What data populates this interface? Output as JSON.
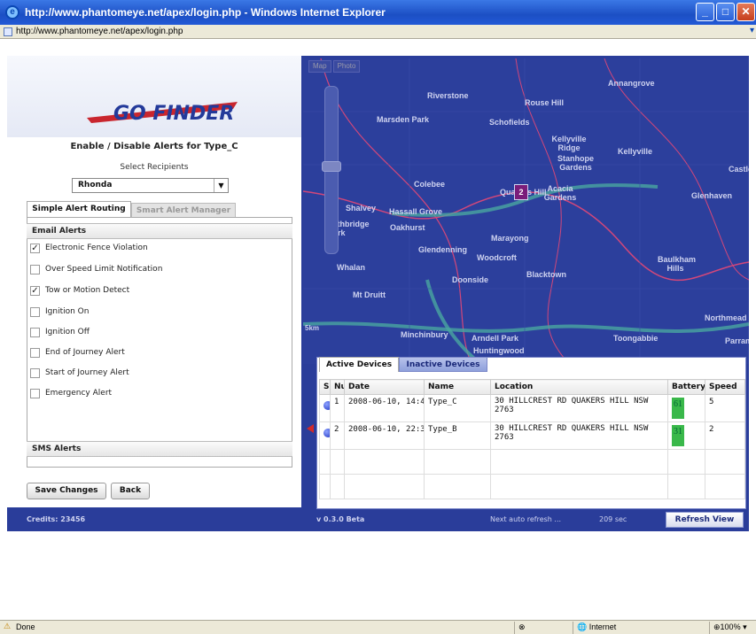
{
  "window": {
    "title": "http://www.phantomeye.net/apex/login.php - Windows Internet Explorer",
    "address": "http://www.phantomeye.net/apex/login.php"
  },
  "logo_text": "GO FINDER",
  "alerts_panel": {
    "title": "Enable / Disable Alerts for Type_C",
    "select_label": "Select Recipients",
    "recipient": "Rhonda",
    "tabs": [
      "Simple Alert Routing",
      "Smart Alert Manager"
    ],
    "email_header": "Email Alerts",
    "items": [
      {
        "label": "Electronic Fence Violation",
        "checked": true
      },
      {
        "label": "Over Speed Limit Notification",
        "checked": false
      },
      {
        "label": "Tow or Motion Detect",
        "checked": true
      },
      {
        "label": "Ignition On",
        "checked": false
      },
      {
        "label": "Ignition Off",
        "checked": false
      },
      {
        "label": "End of Journey Alert",
        "checked": false
      },
      {
        "label": "Start of Journey Alert",
        "checked": false
      },
      {
        "label": "Emergency Alert",
        "checked": false
      }
    ],
    "sms_header": "SMS Alerts",
    "save_label": "Save Changes",
    "back_label": "Back"
  },
  "map": {
    "toggle": [
      "Map",
      "Photo"
    ],
    "labels": [
      "Annangrove",
      "Riverstone",
      "Rouse Hill",
      "Marsden Park",
      "Schofields",
      "Kellyville Ridge",
      "Stanhope Gardens",
      "Kellyville",
      "Colebee",
      "Quakers Hill",
      "Acacia Gardens",
      "Shalvey",
      "Hassall Grove",
      "Lethbridge Park",
      "Oakhurst",
      "Marayong",
      "Glendenning",
      "Woodcroft",
      "Baulkham Hills",
      "Whalan",
      "Blacktown",
      "Doonside",
      "Mt Druitt",
      "Minchinbury",
      "Arndell Park",
      "Huntingwood",
      "Toongabbie",
      "Northmead",
      "Parramatta",
      "Glenhaven",
      "Castle Hill",
      "5km"
    ],
    "marker_label": "2"
  },
  "devices": {
    "tabs": [
      "Active Devices",
      "Inactive Devices"
    ],
    "columns": [
      "S",
      "Nu",
      "Date",
      "Name",
      "Location",
      "Battery",
      "Speed"
    ],
    "rows": [
      {
        "num": "1",
        "date": "2008-06-10, 14:4",
        "name": "Type_C",
        "location": "30 HILLCREST RD QUAKERS HILL NSW 2763",
        "battery": "61",
        "speed": "5"
      },
      {
        "num": "2",
        "date": "2008-06-10, 22:3",
        "name": "Type_B",
        "location": "30 HILLCREST RD QUAKERS HILL NSW 2763",
        "battery": "31",
        "speed": "2"
      }
    ]
  },
  "footer": {
    "credits": "Credits:  23456",
    "version": "v 0.3.0 Beta",
    "refresh_text": "Next auto refresh ...",
    "refresh_seconds": "209 sec",
    "refresh_button": "Refresh View"
  },
  "status": {
    "done": "Done",
    "zone": "Internet",
    "zoom": "100%"
  },
  "colors": {
    "app_bg": "#2a3d9a",
    "battery": "#39b84a",
    "title_bar": "#1c4fc4"
  }
}
